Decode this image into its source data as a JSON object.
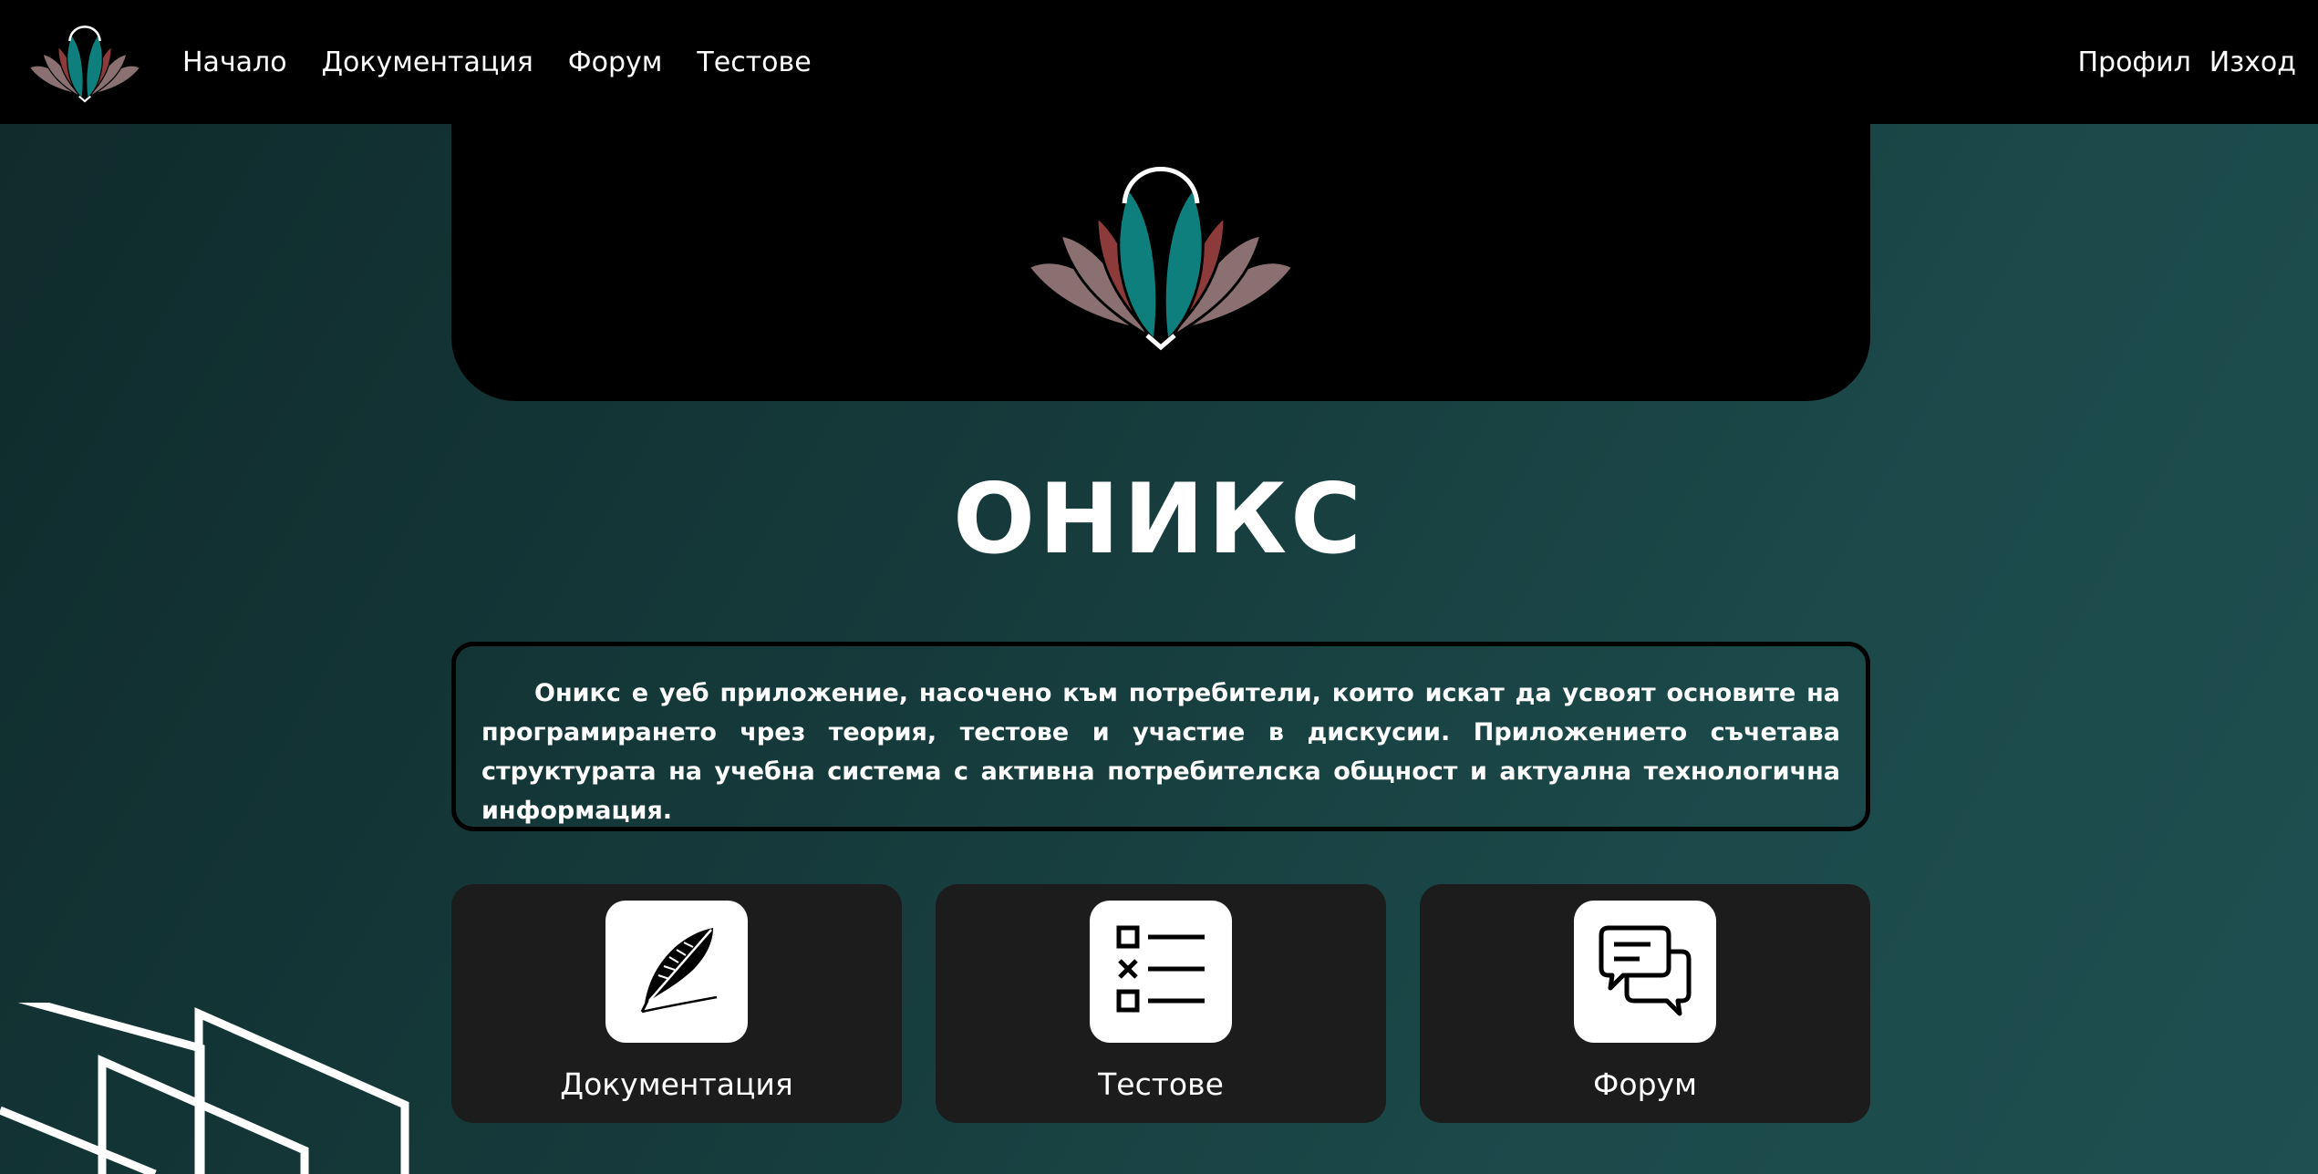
{
  "nav": {
    "links": [
      "Начало",
      "Документация",
      "Форум",
      "Тестове"
    ],
    "right_links": [
      "Профил",
      "Изход"
    ]
  },
  "hero": {
    "title": "ОНИКС"
  },
  "description": "Оникс е уеб приложение, насочено към потребители, които искат да усвоят основите на програмирането чрез теория, тестове и участие в дискусии. Приложението съчетава структурата на учебна система с активна потребителска общност и актуална технологична информация.",
  "cards": [
    {
      "label": "Документация",
      "icon": "quill-icon"
    },
    {
      "label": "Тестове",
      "icon": "checklist-icon"
    },
    {
      "label": "Форум",
      "icon": "chat-bubbles-icon"
    }
  ],
  "colors": {
    "background": "#163b3c",
    "navbar": "#000000",
    "card": "#1c1c1c",
    "teal": "#0e7f7c",
    "red": "#8c3a3a",
    "mauve": "#8a7070"
  }
}
